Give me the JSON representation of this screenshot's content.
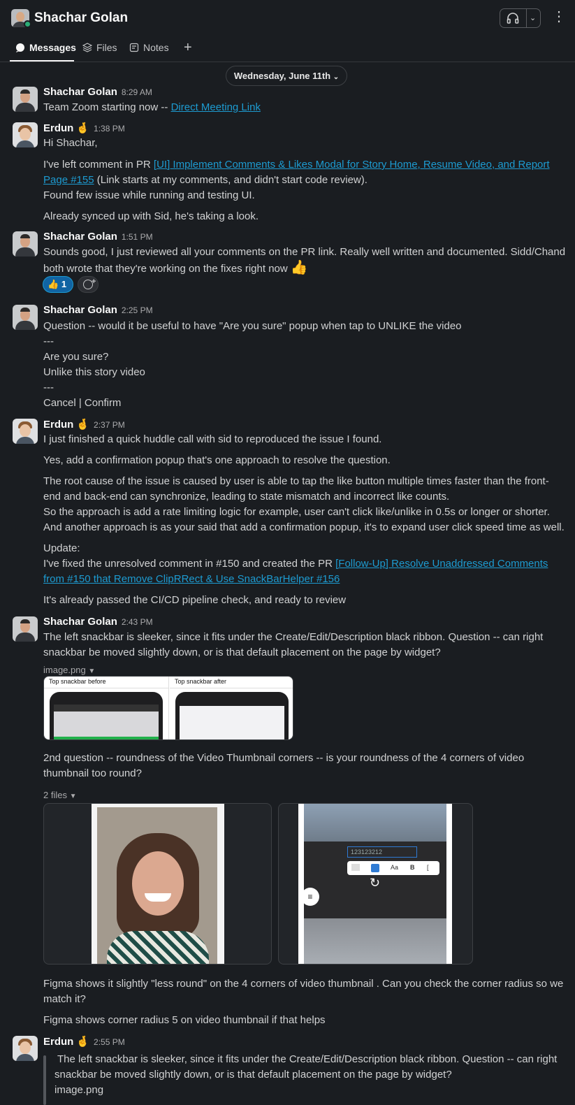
{
  "header": {
    "title": "Shachar Golan",
    "tabs": [
      {
        "label": "Messages",
        "icon": "message-bubble-icon"
      },
      {
        "label": "Files",
        "icon": "layers-icon"
      },
      {
        "label": "Notes",
        "icon": "canvas-note-icon"
      }
    ],
    "add_tab_icon": "plus-icon"
  },
  "date_divider": "Wednesday, June 11th",
  "messages": [
    {
      "author": "Shachar Golan",
      "time": "8:29 AM",
      "text_prefix": "Team Zoom starting now -- ",
      "link": "Direct Meeting Link"
    },
    {
      "author": "Erdun",
      "status_emoji": "🤞",
      "time": "1:38 PM",
      "greeting": "Hi Shachar,",
      "p1_prefix": "I've left comment in PR ",
      "p1_link_a": "[UI] Implement Comments & Likes Modal for Story Home, Resume Video, and Report",
      "p1_link_b": "Page #155",
      "p1_suffix": " (Link starts at my comments, and didn't start code review).",
      "p2": "Found few issue while running and testing UI.",
      "p3": "Already synced up with Sid, he's taking a look."
    },
    {
      "author": "Shachar Golan",
      "time": "1:51 PM",
      "l1": "Sounds good, I just reviewed all your comments on the PR link. Really well written and documented. Sidd/Chand",
      "l2": "both wrote that they're working on the fixes right now",
      "l2_emoji": "👍",
      "reaction_emoji": "👍",
      "reaction_count": "1"
    },
    {
      "author": "Shachar Golan",
      "time": "2:25 PM",
      "lines": [
        "Question -- would it be useful to have \"Are you sure\" popup when tap to UNLIKE the video",
        "---",
        "Are you sure?",
        "Unlike this story video",
        "---",
        "Cancel | Confirm"
      ]
    },
    {
      "author": "Erdun",
      "status_emoji": "🤞",
      "time": "2:37 PM",
      "l1": "I just finished a quick huddle call with sid to reproduced the issue I found.",
      "l2": "Yes, add a confirmation popup that's one approach to resolve the question.",
      "l3": "The root cause of the issue is caused by user is able to tap the like button multiple times faster than the front-",
      "l4": "end and back-end can synchronize, leading to state mismatch and incorrect like counts.",
      "l5": "So the approach is add a rate limiting logic for example, user can't click like/unlike in 0.5s or longer or shorter.",
      "l6": "And another approach is as your said that add a confirmation popup, it's to expand user click speed time as well.",
      "l7": "Update:",
      "l8_prefix": "I've fixed the unresolved comment in #150 and created the PR ",
      "l8_link": "[Follow-Up] Resolve Unaddressed Comments",
      "l9_link": "from #150 that Remove ClipRRect & Use SnackBarHelper #156",
      "l10": "It's already passed the CI/CD pipeline check, and ready to review"
    },
    {
      "author": "Shachar Golan",
      "time": "2:43 PM",
      "l1": "The left snackbar is sleeker, since it fits under the Create/Edit/Description black ribbon. Question -- can right",
      "l2": "snackbar be moved slightly down, or is that default placement on the page by widget?",
      "file1": "image.png",
      "snack_before": "Top snackbar before",
      "snack_after": "Top snackbar after",
      "l3": "2nd question -- roundness of the Video Thumbnail corners -- is your roundness of the 4 corners of video",
      "l4": "thumbnail too round?",
      "files2": "2 files",
      "vid_text": "123123212",
      "vid_toolbar": [
        "Aa",
        "B"
      ],
      "l5": "Figma shows it slightly \"less round\" on the 4 corners of video thumbnail . Can you check the corner radius so we",
      "l6": "match it?",
      "l7": "Figma shows corner radius 5 on video thumbnail if that helps"
    },
    {
      "author": "Erdun",
      "status_emoji": "🤞",
      "time": "2:55 PM",
      "q1": "The left snackbar is sleeker, since it fits under the Create/Edit/Description black ribbon. Question -- can right",
      "q2": "snackbar be moved slightly down, or is that default placement on the page by widget?",
      "q3": "image.png"
    }
  ],
  "colors": {
    "background": "#1a1d21",
    "link": "#1d9bd1",
    "presence": "#2bac76",
    "reaction": "#1164a3"
  }
}
